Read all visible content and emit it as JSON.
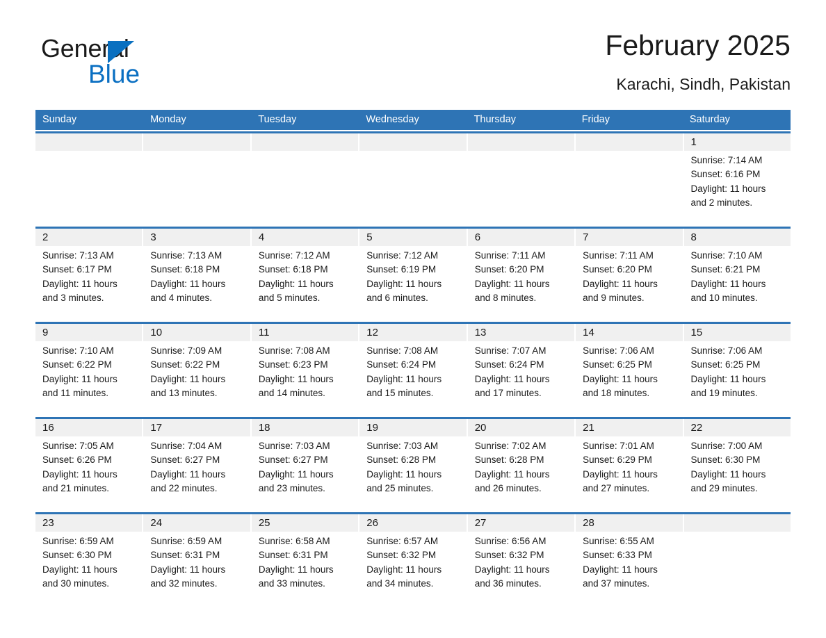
{
  "brand": {
    "name_part1": "General",
    "name_part2": "Blue",
    "triangle_icon": "triangle-icon",
    "color_black": "#1a1a1a",
    "color_blue": "#0a6fc2"
  },
  "header": {
    "title": "February 2025",
    "location": "Karachi, Sindh, Pakistan"
  },
  "theme": {
    "header_blue": "#2e74b5",
    "day_band_gray": "#f0f0f0",
    "cell_white": "#ffffff",
    "text_black": "#1a1a1a"
  },
  "weekdays": [
    "Sunday",
    "Monday",
    "Tuesday",
    "Wednesday",
    "Thursday",
    "Friday",
    "Saturday"
  ],
  "labels": {
    "sunrise_prefix": "Sunrise:",
    "sunset_prefix": "Sunset:",
    "daylight_prefix": "Daylight:"
  },
  "weeks": [
    [
      {
        "day": "",
        "sunrise": "",
        "sunset": "",
        "daylight": ""
      },
      {
        "day": "",
        "sunrise": "",
        "sunset": "",
        "daylight": ""
      },
      {
        "day": "",
        "sunrise": "",
        "sunset": "",
        "daylight": ""
      },
      {
        "day": "",
        "sunrise": "",
        "sunset": "",
        "daylight": ""
      },
      {
        "day": "",
        "sunrise": "",
        "sunset": "",
        "daylight": ""
      },
      {
        "day": "",
        "sunrise": "",
        "sunset": "",
        "daylight": ""
      },
      {
        "day": "1",
        "sunrise": "Sunrise: 7:14 AM",
        "sunset": "Sunset: 6:16 PM",
        "daylight": "Daylight: 11 hours and 2 minutes."
      }
    ],
    [
      {
        "day": "2",
        "sunrise": "Sunrise: 7:13 AM",
        "sunset": "Sunset: 6:17 PM",
        "daylight": "Daylight: 11 hours and 3 minutes."
      },
      {
        "day": "3",
        "sunrise": "Sunrise: 7:13 AM",
        "sunset": "Sunset: 6:18 PM",
        "daylight": "Daylight: 11 hours and 4 minutes."
      },
      {
        "day": "4",
        "sunrise": "Sunrise: 7:12 AM",
        "sunset": "Sunset: 6:18 PM",
        "daylight": "Daylight: 11 hours and 5 minutes."
      },
      {
        "day": "5",
        "sunrise": "Sunrise: 7:12 AM",
        "sunset": "Sunset: 6:19 PM",
        "daylight": "Daylight: 11 hours and 6 minutes."
      },
      {
        "day": "6",
        "sunrise": "Sunrise: 7:11 AM",
        "sunset": "Sunset: 6:20 PM",
        "daylight": "Daylight: 11 hours and 8 minutes."
      },
      {
        "day": "7",
        "sunrise": "Sunrise: 7:11 AM",
        "sunset": "Sunset: 6:20 PM",
        "daylight": "Daylight: 11 hours and 9 minutes."
      },
      {
        "day": "8",
        "sunrise": "Sunrise: 7:10 AM",
        "sunset": "Sunset: 6:21 PM",
        "daylight": "Daylight: 11 hours and 10 minutes."
      }
    ],
    [
      {
        "day": "9",
        "sunrise": "Sunrise: 7:10 AM",
        "sunset": "Sunset: 6:22 PM",
        "daylight": "Daylight: 11 hours and 11 minutes."
      },
      {
        "day": "10",
        "sunrise": "Sunrise: 7:09 AM",
        "sunset": "Sunset: 6:22 PM",
        "daylight": "Daylight: 11 hours and 13 minutes."
      },
      {
        "day": "11",
        "sunrise": "Sunrise: 7:08 AM",
        "sunset": "Sunset: 6:23 PM",
        "daylight": "Daylight: 11 hours and 14 minutes."
      },
      {
        "day": "12",
        "sunrise": "Sunrise: 7:08 AM",
        "sunset": "Sunset: 6:24 PM",
        "daylight": "Daylight: 11 hours and 15 minutes."
      },
      {
        "day": "13",
        "sunrise": "Sunrise: 7:07 AM",
        "sunset": "Sunset: 6:24 PM",
        "daylight": "Daylight: 11 hours and 17 minutes."
      },
      {
        "day": "14",
        "sunrise": "Sunrise: 7:06 AM",
        "sunset": "Sunset: 6:25 PM",
        "daylight": "Daylight: 11 hours and 18 minutes."
      },
      {
        "day": "15",
        "sunrise": "Sunrise: 7:06 AM",
        "sunset": "Sunset: 6:25 PM",
        "daylight": "Daylight: 11 hours and 19 minutes."
      }
    ],
    [
      {
        "day": "16",
        "sunrise": "Sunrise: 7:05 AM",
        "sunset": "Sunset: 6:26 PM",
        "daylight": "Daylight: 11 hours and 21 minutes."
      },
      {
        "day": "17",
        "sunrise": "Sunrise: 7:04 AM",
        "sunset": "Sunset: 6:27 PM",
        "daylight": "Daylight: 11 hours and 22 minutes."
      },
      {
        "day": "18",
        "sunrise": "Sunrise: 7:03 AM",
        "sunset": "Sunset: 6:27 PM",
        "daylight": "Daylight: 11 hours and 23 minutes."
      },
      {
        "day": "19",
        "sunrise": "Sunrise: 7:03 AM",
        "sunset": "Sunset: 6:28 PM",
        "daylight": "Daylight: 11 hours and 25 minutes."
      },
      {
        "day": "20",
        "sunrise": "Sunrise: 7:02 AM",
        "sunset": "Sunset: 6:28 PM",
        "daylight": "Daylight: 11 hours and 26 minutes."
      },
      {
        "day": "21",
        "sunrise": "Sunrise: 7:01 AM",
        "sunset": "Sunset: 6:29 PM",
        "daylight": "Daylight: 11 hours and 27 minutes."
      },
      {
        "day": "22",
        "sunrise": "Sunrise: 7:00 AM",
        "sunset": "Sunset: 6:30 PM",
        "daylight": "Daylight: 11 hours and 29 minutes."
      }
    ],
    [
      {
        "day": "23",
        "sunrise": "Sunrise: 6:59 AM",
        "sunset": "Sunset: 6:30 PM",
        "daylight": "Daylight: 11 hours and 30 minutes."
      },
      {
        "day": "24",
        "sunrise": "Sunrise: 6:59 AM",
        "sunset": "Sunset: 6:31 PM",
        "daylight": "Daylight: 11 hours and 32 minutes."
      },
      {
        "day": "25",
        "sunrise": "Sunrise: 6:58 AM",
        "sunset": "Sunset: 6:31 PM",
        "daylight": "Daylight: 11 hours and 33 minutes."
      },
      {
        "day": "26",
        "sunrise": "Sunrise: 6:57 AM",
        "sunset": "Sunset: 6:32 PM",
        "daylight": "Daylight: 11 hours and 34 minutes."
      },
      {
        "day": "27",
        "sunrise": "Sunrise: 6:56 AM",
        "sunset": "Sunset: 6:32 PM",
        "daylight": "Daylight: 11 hours and 36 minutes."
      },
      {
        "day": "28",
        "sunrise": "Sunrise: 6:55 AM",
        "sunset": "Sunset: 6:33 PM",
        "daylight": "Daylight: 11 hours and 37 minutes."
      },
      {
        "day": "",
        "sunrise": "",
        "sunset": "",
        "daylight": ""
      }
    ]
  ]
}
